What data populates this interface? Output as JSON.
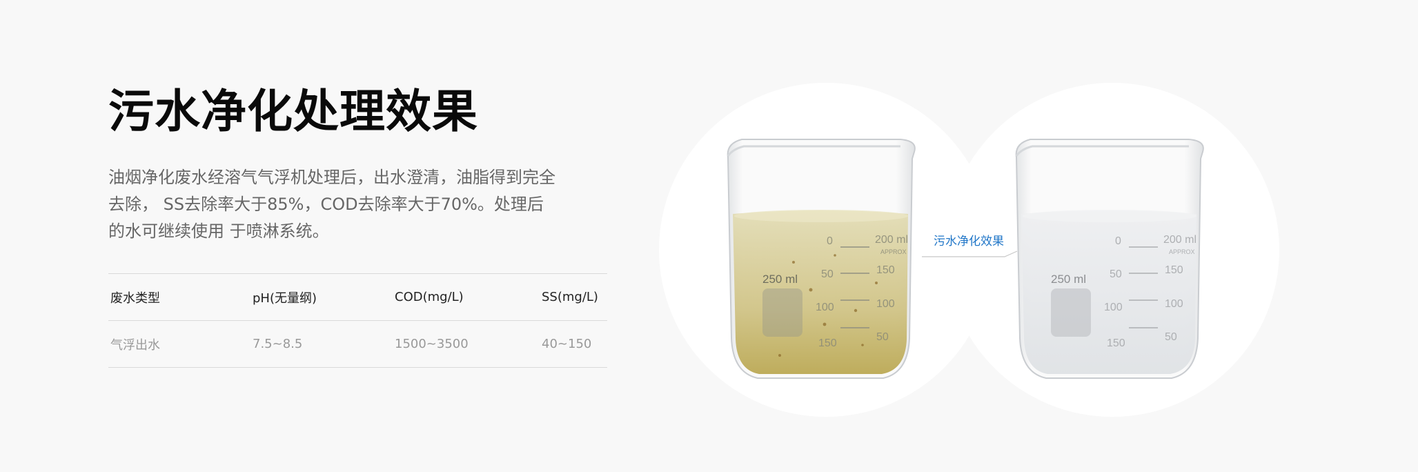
{
  "title": "污水净化处理效果",
  "description": "油烟净化废水经溶气气浮机处理后，出水澄清，油脂得到完全去除， SS去除率大于85%，COD去除率大于70%。处理后的水可继续使用 于喷淋系统。",
  "table": {
    "headers": [
      "废水类型",
      "pH(无量纲)",
      "COD(mg/L)",
      "SS(mg/L)"
    ],
    "row": [
      "气浮出水",
      "7.5~8.5",
      "1500~3500",
      "40~150"
    ]
  },
  "comparison": {
    "label": "污水净化效果",
    "beaker_capacity": "250 ml",
    "brand": "APPROX",
    "scale_marks": [
      "0",
      "50",
      "100",
      "150",
      "200 ml"
    ],
    "scale_marks_right": [
      "200",
      "150",
      "100",
      "50"
    ]
  },
  "colors": {
    "title": "#0a0a0a",
    "text": "#666666",
    "accent": "#2277c8",
    "dirty_water": "#c9b96a",
    "clean_water": "#e6e9ec",
    "background": "#f8f8f8"
  }
}
